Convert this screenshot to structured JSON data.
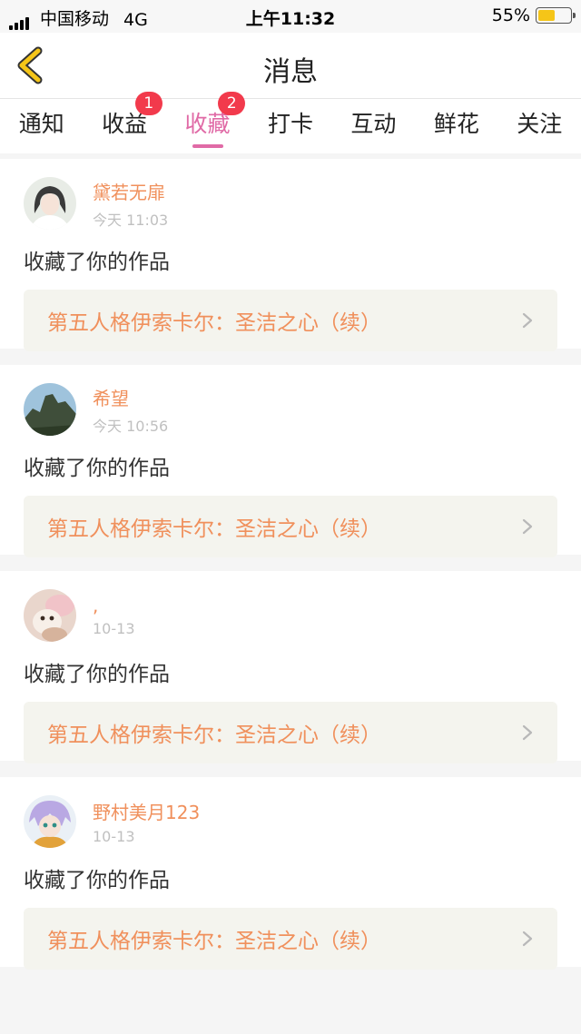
{
  "status": {
    "carrier": "中国移动",
    "network": "4G",
    "time": "上午11:32",
    "battery": "55%",
    "battery_level": 0.55
  },
  "nav": {
    "title": "消息",
    "back_icon": "chevron-left-icon",
    "accent": "#f5c518"
  },
  "tabs": [
    {
      "label": "通知"
    },
    {
      "label": "收益",
      "badge": "1"
    },
    {
      "label": "收藏",
      "badge": "2",
      "active": true
    },
    {
      "label": "打卡"
    },
    {
      "label": "互动"
    },
    {
      "label": "鲜花"
    },
    {
      "label": "关注"
    }
  ],
  "colors": {
    "active_tab": "#e06aa6",
    "badge": "#f23a4c",
    "username": "#f0905c",
    "work_title": "#f0905c"
  },
  "messages": [
    {
      "user": "黛若无扉",
      "time": "今天 11:03",
      "action": "收藏了你的作品",
      "work": "第五人格伊索卡尔：圣洁之心（续）"
    },
    {
      "user": "希望",
      "time": "今天 10:56",
      "action": "收藏了你的作品",
      "work": "第五人格伊索卡尔：圣洁之心（续）"
    },
    {
      "user": ",",
      "time": "10-13",
      "action": "收藏了你的作品",
      "work": "第五人格伊索卡尔：圣洁之心（续）"
    },
    {
      "user": "野村美月123",
      "time": "10-13",
      "action": "收藏了你的作品",
      "work": "第五人格伊索卡尔：圣洁之心（续）"
    }
  ]
}
